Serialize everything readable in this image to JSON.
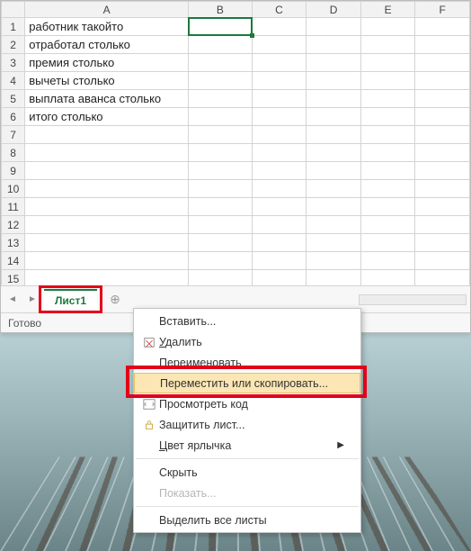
{
  "columns": [
    "A",
    "B",
    "C",
    "D",
    "E",
    "F"
  ],
  "rows": [
    {
      "num": 1,
      "a": "работник такойто"
    },
    {
      "num": 2,
      "a": "отработал столько"
    },
    {
      "num": 3,
      "a": "премия столько"
    },
    {
      "num": 4,
      "a": "вычеты столько"
    },
    {
      "num": 5,
      "a": "выплата аванса столько"
    },
    {
      "num": 6,
      "a": "итого столько"
    },
    {
      "num": 7,
      "a": ""
    },
    {
      "num": 8,
      "a": ""
    },
    {
      "num": 9,
      "a": ""
    },
    {
      "num": 10,
      "a": ""
    },
    {
      "num": 11,
      "a": ""
    },
    {
      "num": 12,
      "a": ""
    },
    {
      "num": 13,
      "a": ""
    },
    {
      "num": 14,
      "a": ""
    },
    {
      "num": 15,
      "a": ""
    }
  ],
  "selected_cell": {
    "row": 1,
    "col": "B"
  },
  "sheet_tab": "Лист1",
  "status": "Готово",
  "menu": {
    "insert": "Вставить...",
    "delete_u": "У",
    "delete_rest": "далить",
    "rename": "Переименовать",
    "move_copy": "Переместить или скопировать...",
    "view_code": "Просмотреть код",
    "protect": "Защитить лист...",
    "tab_color_u": "Ц",
    "tab_color_rest": "вет ярлычка",
    "hide": "Скрыть",
    "show": "Показать...",
    "select_all": "Выделить все листы"
  }
}
